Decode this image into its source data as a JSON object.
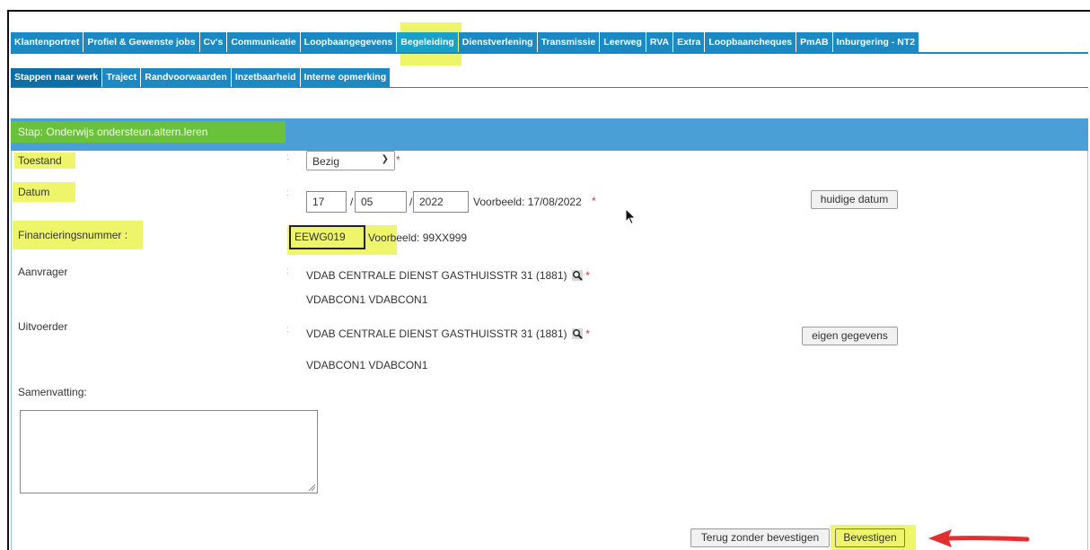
{
  "tabs": [
    "Klantenportret",
    "Profiel & Gewenste jobs",
    "Cv's",
    "Communicatie",
    "Loopbaangegevens",
    "Begeleiding",
    "Dienstverlening",
    "Transmissie",
    "Leerweg",
    "RVA",
    "Extra",
    "Loopbaancheques",
    "PmAB",
    "Inburgering - NT2"
  ],
  "active_tab": "Begeleiding",
  "subtabs": [
    "Stappen naar werk",
    "Traject",
    "Randvoorwaarden",
    "Inzetbaarheid",
    "Interne opmerking"
  ],
  "active_subtab": "Stappen naar werk",
  "panel": {
    "title": "Stap: Onderwijs ondersteun.altern.leren"
  },
  "form": {
    "toestand_label": "Toestand",
    "toestand_value": "Bezig",
    "datum_label": "Datum",
    "datum_day": "17",
    "datum_month": "05",
    "datum_year": "2022",
    "datum_sep": "/",
    "datum_example": "Voorbeeld: 17/08/2022",
    "huidige_datum_button": "huidige datum",
    "financiering_label": "Financieringsnummer :",
    "financiering_value": "EEWG019",
    "financiering_example": "Voorbeeld: 99XX999",
    "aanvrager_label": "Aanvrager",
    "aanvrager_value": "VDAB CENTRALE DIENST GASTHUISSTR 31 (1881)",
    "aanvrager_sub": "VDABCON1 VDABCON1",
    "uitvoerder_label": "Uitvoerder",
    "uitvoerder_value": "VDAB CENTRALE DIENST GASTHUISSTR 31 (1881)",
    "uitvoerder_sub": "VDABCON1 VDABCON1",
    "eigen_gegevens_button": "eigen gegevens",
    "samenvatting_label": "Samenvatting:",
    "colon": ":",
    "required_mark": "*"
  },
  "actions": {
    "back_button": "Terug zonder bevestigen",
    "confirm_button": "Bevestigen"
  },
  "colors": {
    "tab_blue": "#1a89c4",
    "highlight_yellow": "#eef56a",
    "step_green": "#6ac23a",
    "arrow_red": "#e03030"
  }
}
